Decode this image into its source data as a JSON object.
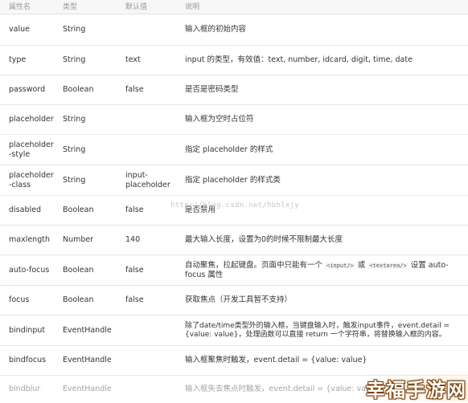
{
  "header": {
    "col1": "属性名",
    "col2": "类型",
    "col3": "默认值",
    "col4": "说明"
  },
  "rows": [
    {
      "name": "value",
      "type": "String",
      "default": "",
      "desc": "输入框的初始内容"
    },
    {
      "name": "type",
      "type": "String",
      "default": "text",
      "desc": "input 的类型，有效值：text, number, idcard, digit, time, date"
    },
    {
      "name": "password",
      "type": "Boolean",
      "default": "false",
      "desc": "是否是密码类型"
    },
    {
      "name": "placeholder",
      "type": "String",
      "default": "",
      "desc": "输入框为空时占位符"
    },
    {
      "name": "placeholder-style",
      "type": "String",
      "default": "",
      "desc": "指定 placeholder 的样式"
    },
    {
      "name": "placeholder-class",
      "type": "String",
      "default": "input-placeholder",
      "desc": "指定 placeholder 的样式类"
    },
    {
      "name": "disabled",
      "type": "Boolean",
      "default": "false",
      "desc": "是否禁用"
    },
    {
      "name": "maxlength",
      "type": "Number",
      "default": "140",
      "desc": "最大输入长度，设置为0的时候不限制最大长度"
    },
    {
      "name": "auto-focus",
      "type": "Boolean",
      "default": "false",
      "desc_a": "自动聚焦，拉起键盘。页面中只能有一个",
      "code1": "<input/>",
      "desc_b": "或",
      "code2": "<textarea/>",
      "desc_c": "设置 auto-focus 属性"
    },
    {
      "name": "focus",
      "type": "Boolean",
      "default": "false",
      "desc": "获取焦点（开发工具暂不支持）"
    },
    {
      "name": "bindinput",
      "type": "EventHandle",
      "default": "",
      "desc": "除了date/time类型外的输入框，当键盘输入时，触发input事件，event.detail = {value: value}，处理函数可以直接 return 一个字符串，将替换输入框的内容。"
    },
    {
      "name": "bindfocus",
      "type": "EventHandle",
      "default": "",
      "desc": "输入框聚焦时触发，event.detail = {value: value}"
    },
    {
      "name": "bindblur",
      "type": "EventHandle",
      "default": "",
      "desc": "输入框失去焦点时触发，event.detail = {value: value}"
    }
  ],
  "watermark": "http://blog.csdn.net/hbhlxjy",
  "brand": "幸福手游网"
}
